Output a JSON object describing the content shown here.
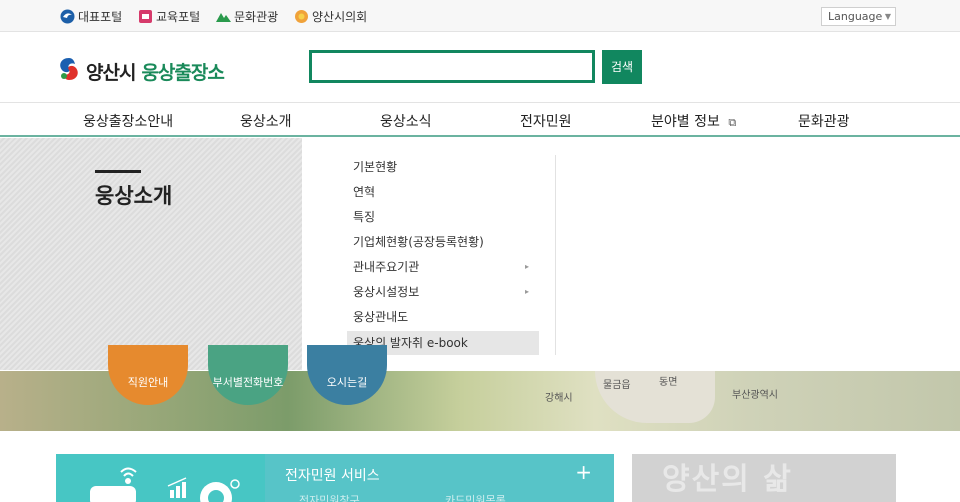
{
  "colors": {
    "brand_green": "#11875f",
    "teal": "#57c4c8",
    "accent_line": "#6bb3a0"
  },
  "topbar": {
    "portals": [
      {
        "label": "대표포털",
        "icon": "city-emblem-icon"
      },
      {
        "label": "교육포털",
        "icon": "education-icon"
      },
      {
        "label": "문화관광",
        "icon": "mountain-icon"
      },
      {
        "label": "양산시의회",
        "icon": "sun-emblem-icon"
      }
    ],
    "language": "Language"
  },
  "header": {
    "logo_name": "양산시",
    "logo_sub": "웅상출장소",
    "search_button": "검색",
    "search_value": ""
  },
  "gnb": {
    "items": [
      "웅상출장소안내",
      "웅상소개",
      "웅상소식",
      "전자민원",
      "분야별 정보",
      "문화관광"
    ]
  },
  "section_title": "웅상소개",
  "submenu": {
    "items": [
      {
        "label": "기본현황",
        "has_children": false
      },
      {
        "label": "연혁",
        "has_children": false
      },
      {
        "label": "특징",
        "has_children": false
      },
      {
        "label": "기업체현황(공장등록현황)",
        "has_children": false
      },
      {
        "label": "관내주요기관",
        "has_children": true
      },
      {
        "label": "웅상시설정보",
        "has_children": true
      },
      {
        "label": "웅상관내도",
        "has_children": false
      },
      {
        "label": "웅상의 발자취 e-book",
        "has_children": false,
        "active": true
      }
    ]
  },
  "banner": {
    "buttons": [
      "직원안내",
      "부서별전화번호",
      "오시는길"
    ],
    "map_labels": [
      "물금읍",
      "동면",
      "강해시",
      "부산광역시"
    ]
  },
  "civil": {
    "title": "전자민원 서비스",
    "plus": "+",
    "sub_left": "전자민원창구",
    "sub_right": "카드민원목록",
    "right_box_text": "양산의 삶"
  }
}
